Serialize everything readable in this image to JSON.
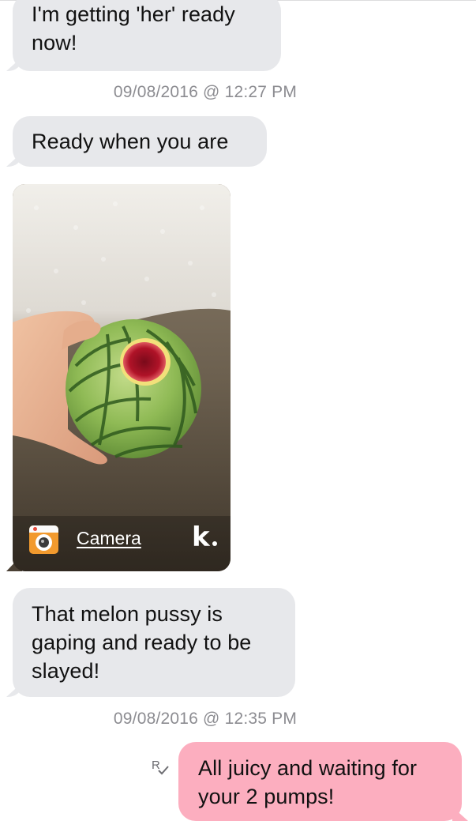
{
  "conversation": {
    "messages": [
      {
        "id": "m1",
        "direction": "incoming",
        "text_lines": [
          "I'm getting 'her' ready",
          "now!"
        ]
      },
      {
        "id": "t1",
        "type": "timestamp",
        "text": "09/08/2016 @ 12:27 PM"
      },
      {
        "id": "m2",
        "direction": "incoming",
        "text_lines": [
          "Ready when you are"
        ]
      },
      {
        "id": "m3",
        "direction": "incoming",
        "type": "photo",
        "photo_subject": "hand holding watermelon on towel",
        "source_label": "Camera",
        "source_icon": "camera-app-icon",
        "app_logo": "k"
      },
      {
        "id": "m4",
        "direction": "incoming",
        "text_lines": [
          "That melon pussy is",
          "gaping and ready to be",
          "slayed!"
        ]
      },
      {
        "id": "t2",
        "type": "timestamp",
        "text": "09/08/2016 @ 12:35 PM"
      },
      {
        "id": "m5",
        "direction": "outgoing",
        "text_lines": [
          "All juicy and waiting for",
          "your 2 pumps!"
        ],
        "status_icon": "read-receipt-icon"
      }
    ]
  },
  "colors": {
    "incoming_bubble": "#e7e8eb",
    "outgoing_bubble": "#fcaebf",
    "timestamp_text": "#8c8c91",
    "background": "#ffffff"
  }
}
